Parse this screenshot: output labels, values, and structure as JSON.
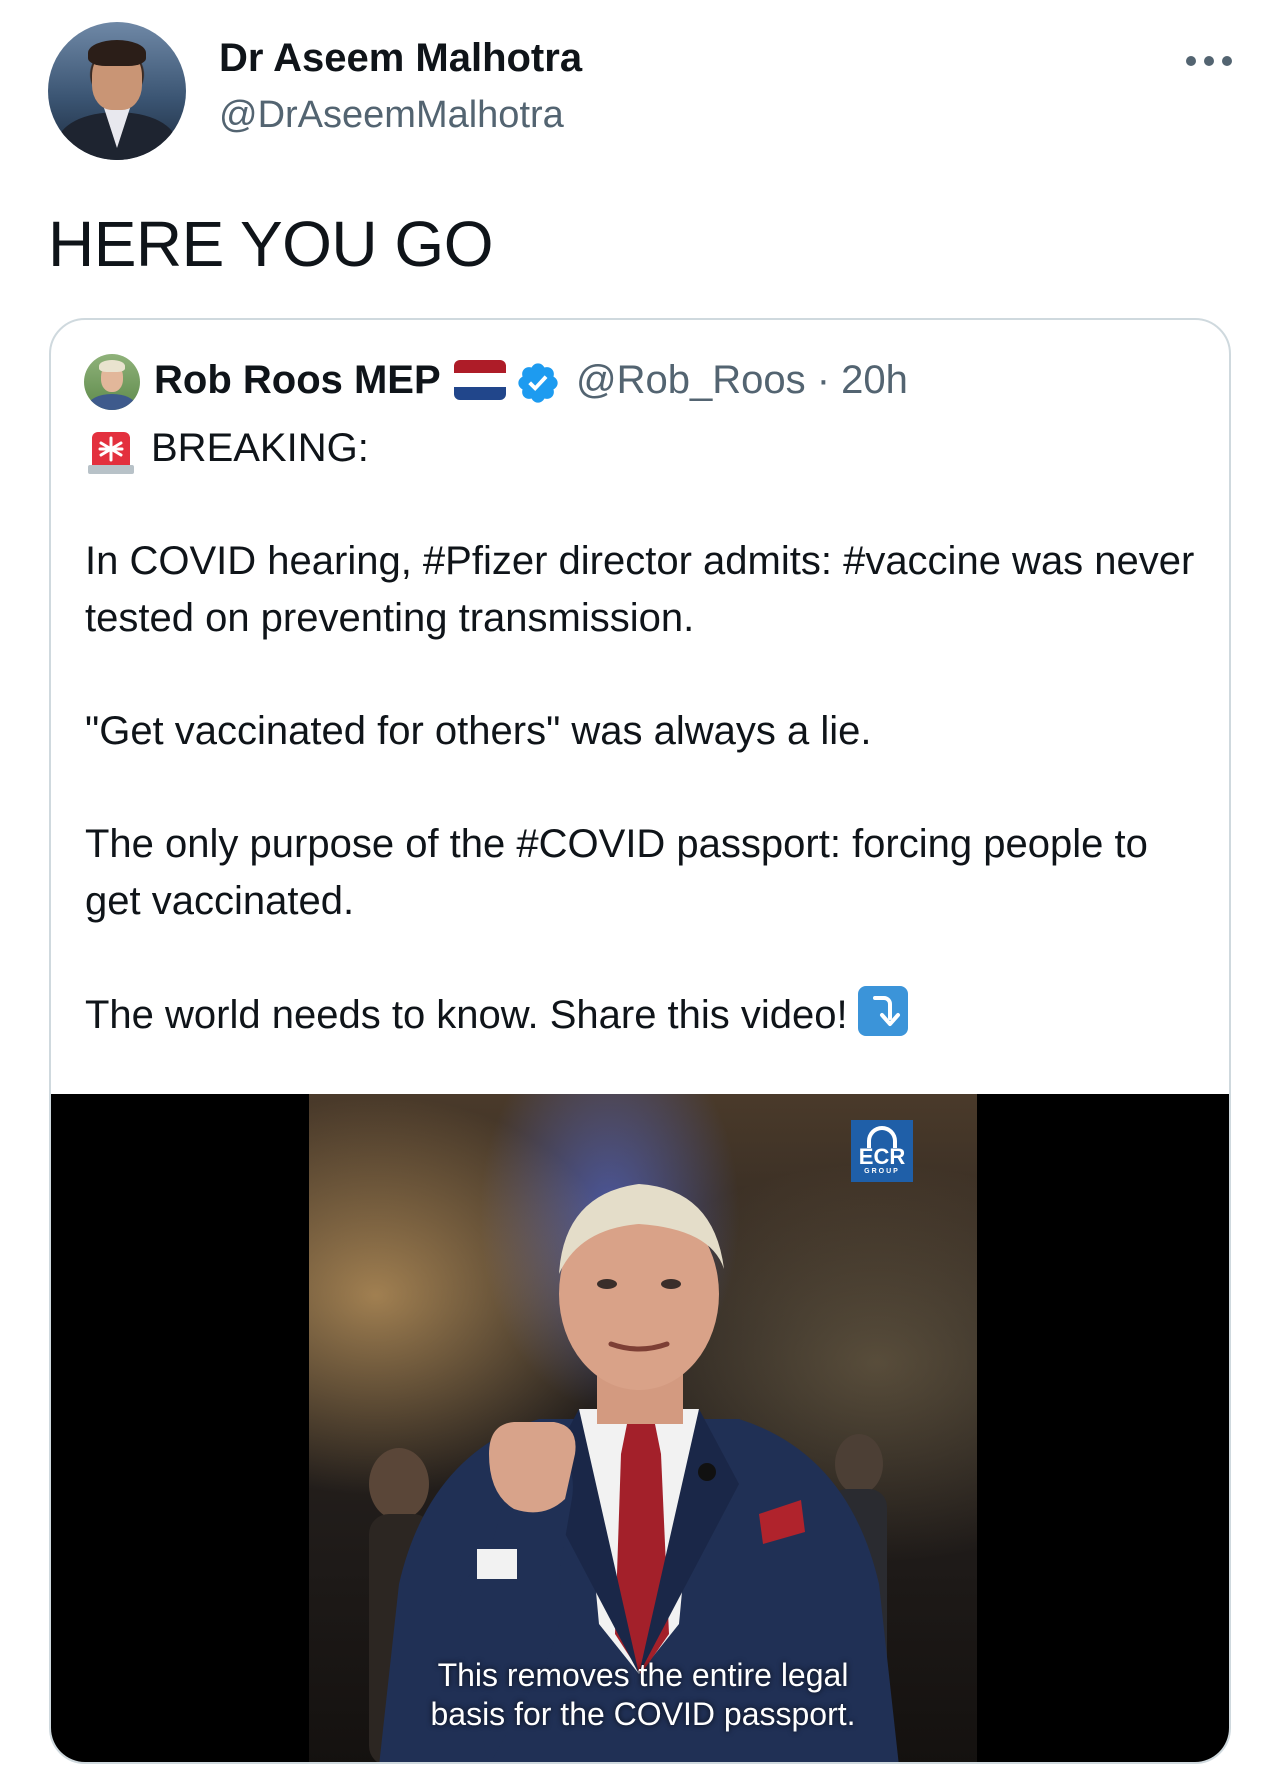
{
  "author": {
    "name": "Dr Aseem Malhotra",
    "handle": "@DrAseemMalhotra",
    "avatar_icon": "profile-photo"
  },
  "tweet": {
    "text": "HERE YOU GO"
  },
  "menu": {
    "icon": "more-options-icon"
  },
  "quoted_tweet": {
    "author_name": "Rob Roos MEP",
    "flag_icon": "netherlands-flag-icon",
    "verified_icon": "verified-badge-icon",
    "handle_time": "@Rob_Roos · 20h",
    "siren_icon": "police-siren-emoji",
    "lines": [
      "BREAKING:",
      "In COVID hearing, #Pfizer director admits: #vaccine was never tested on preventing transmission.",
      "\"Get vaccinated for others\" was always a lie.",
      "The only purpose of the #COVID passport: forcing people to get vaccinated.",
      "The world needs to know. Share this video!"
    ],
    "arrow_icon": "arrow-down-emoji",
    "video": {
      "logo_text": "ECR",
      "logo_subtext": "GROUP",
      "caption_line1": "This removes the entire legal",
      "caption_line2": "basis for the COVID passport."
    }
  },
  "colors": {
    "text": "#0f1419",
    "secondary": "#536471",
    "border": "#cfd9de",
    "verified": "#1d9bf0",
    "ecr_blue": "#1f5fa8"
  }
}
